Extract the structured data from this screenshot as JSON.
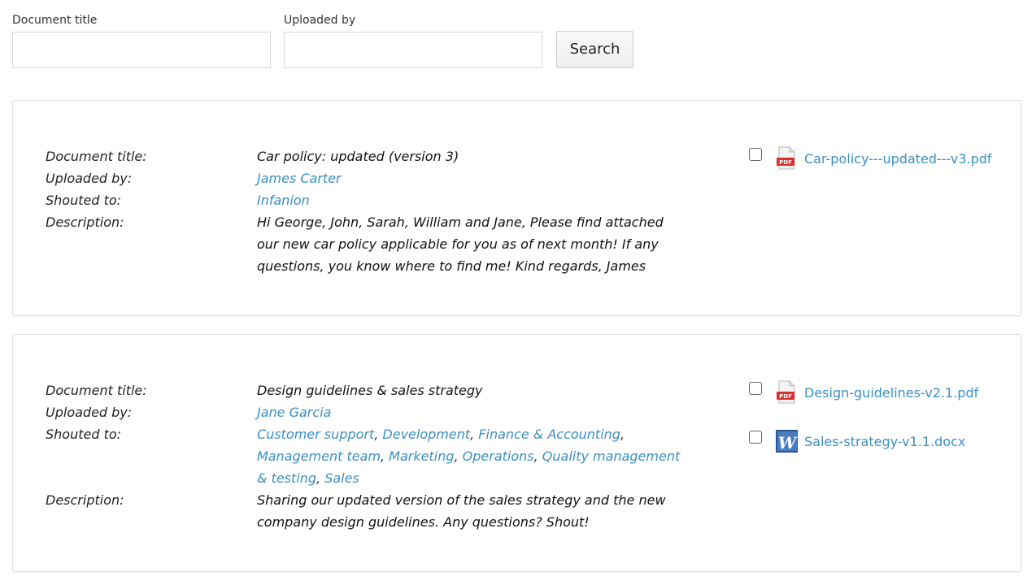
{
  "search": {
    "title_label": "Document title",
    "title_value": "",
    "uploader_label": "Uploaded by",
    "uploader_value": "",
    "button_label": "Search"
  },
  "labels": {
    "title": "Document title",
    "uploaded_by": "Uploaded by",
    "shouted_to": "Shouted to",
    "description": "Description",
    "colon": ":"
  },
  "documents": [
    {
      "title": "Car policy: updated (version 3)",
      "uploaded_by": "James Carter",
      "shouted_to": [
        "Infanion"
      ],
      "description": "Hi George, John, Sarah, William and Jane, Please find attached our new car policy applicable for you as of next month! If any questions, you know where to find me! Kind regards, James",
      "files": [
        {
          "name": "Car-policy---updated---v3.pdf",
          "icon": "pdf-icon",
          "checked": false
        }
      ]
    },
    {
      "title": "Design guidelines & sales strategy",
      "uploaded_by": "Jane Garcia",
      "shouted_to": [
        "Customer support",
        "Development",
        "Finance & Accounting",
        "Management team",
        "Marketing",
        "Operations",
        "Quality management & testing",
        "Sales"
      ],
      "description": "Sharing our updated version of the sales strategy and the new company design guidelines. Any questions? Shout!",
      "files": [
        {
          "name": "Design-guidelines-v2.1.pdf",
          "icon": "pdf-icon",
          "checked": false
        },
        {
          "name": "Sales-strategy-v1.1.docx",
          "icon": "word-icon",
          "checked": false
        }
      ]
    }
  ],
  "colors": {
    "link": "#3a8fc4",
    "border": "#dcdcdc",
    "pdf_red": "#d9322b",
    "word_blue": "#2b5797"
  }
}
